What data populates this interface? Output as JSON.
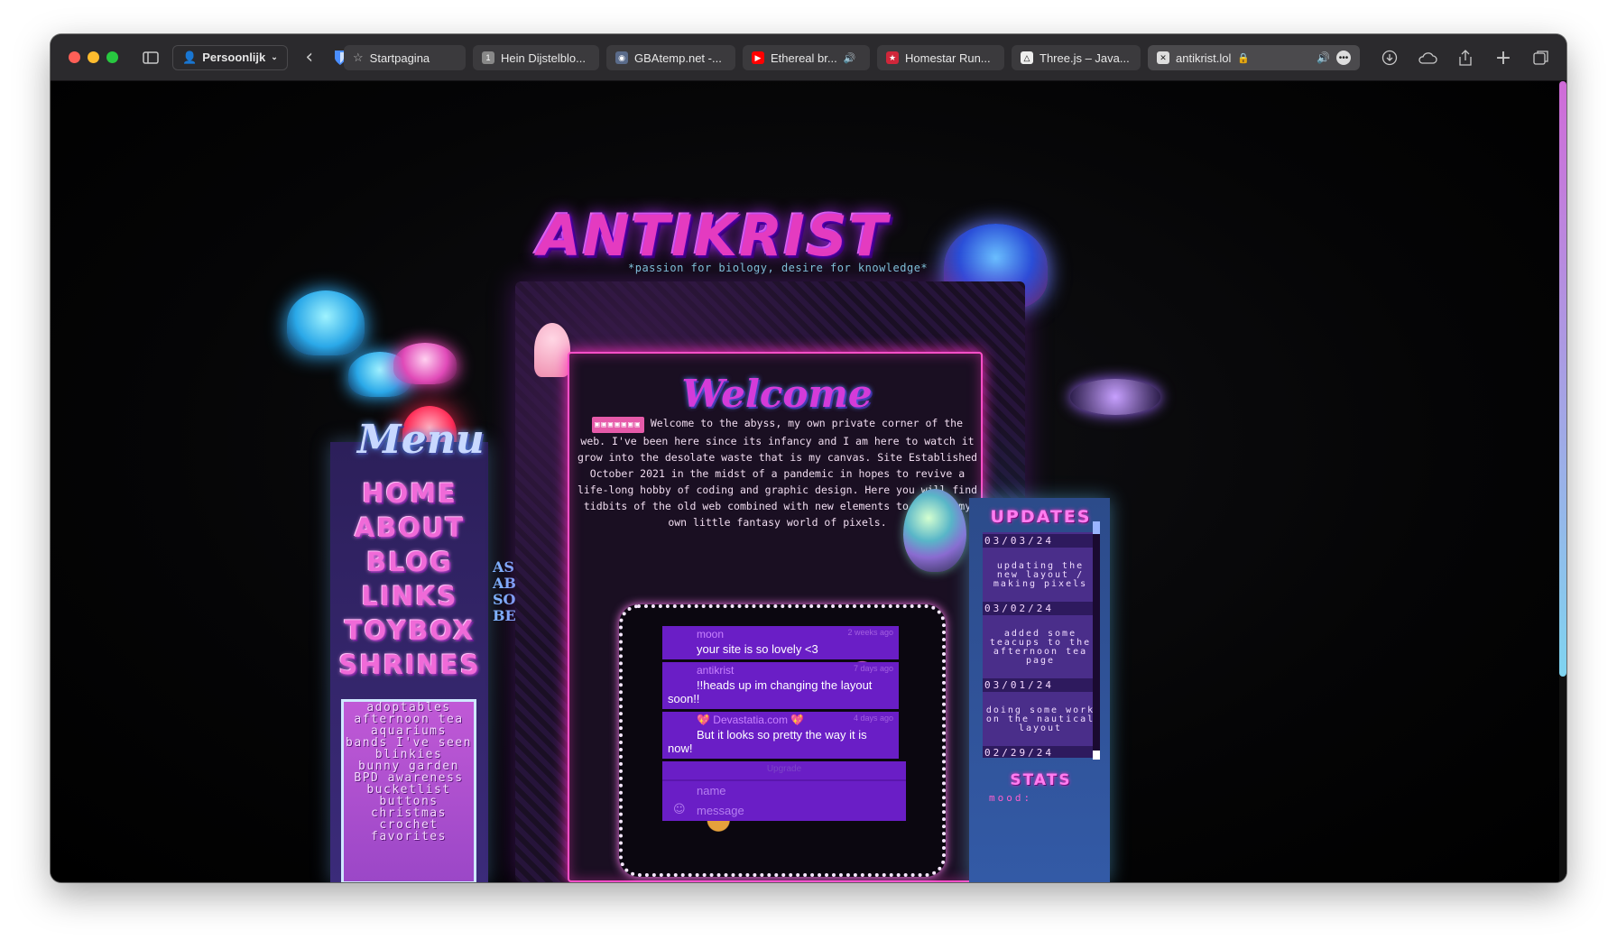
{
  "browser": {
    "profile_label": "Persoonlijk",
    "tabs": [
      {
        "label": "Startpagina",
        "icon": "star-icon"
      },
      {
        "label": "Hein Dijstelblo...",
        "icon": "bookmark-1-icon"
      },
      {
        "label": "GBAtemp.net -...",
        "icon": "gbatemp-icon"
      },
      {
        "label": "Ethereal br...",
        "icon": "youtube-icon",
        "audio": "speaker-icon"
      },
      {
        "label": "Homestar Run...",
        "icon": "homestar-icon"
      },
      {
        "label": "Three.js – Java...",
        "icon": "threejs-icon"
      },
      {
        "label": "antikrist.lol",
        "icon": "close-x-icon",
        "secure": "lock-icon",
        "active": true
      }
    ],
    "colors": {
      "close": "#ff5f57",
      "minimize": "#febc2e",
      "zoom": "#28c840"
    }
  },
  "site": {
    "logo": "ANTIKRIST",
    "tagline": "*passion for biology, desire for knowledge*",
    "menu_title": "Menu",
    "nav": [
      "HOME",
      "ABOUT",
      "BLOG",
      "LINKS",
      "TOYBOX",
      "SHRINES"
    ],
    "shrines": [
      "adoptables",
      "afternoon tea",
      "aquariums",
      "bands I've seen",
      "blinkies",
      "bunny garden",
      "BPD awareness",
      "bucketlist",
      "buttons",
      "christmas",
      "crochet",
      "favorites"
    ],
    "vertical_text": "AS ABOVE SO BELOW",
    "welcome_title": "Welcome",
    "intro_badge": "▣▣▣▣▣▣▣",
    "intro_text": "Welcome to the abyss, my own private corner of the web. I've been here since its infancy and I am here to watch it grow into the desolate waste that is my canvas. Site Established October 2021 in the midst of a pandemic in hopes to revive a life-long hobby of coding and graphic design. Here you will find tidbits of the old web combined with new elements to create my own little fantasy world of pixels.",
    "chat": {
      "messages": [
        {
          "name": "moon",
          "time": "2 weeks ago",
          "text": "your site is so lovely <3"
        },
        {
          "name": "antikrist",
          "time": "7 days ago",
          "text": "!!heads up im changing the layout soon!!"
        },
        {
          "name": "💖 Devastatia.com 💖",
          "time": "4 days ago",
          "text": "But it looks so pretty the way it is now!"
        }
      ],
      "upgrade": "Upgrade",
      "name_placeholder": "name",
      "message_placeholder": "message"
    },
    "updates_title": "UPDATES",
    "updates": [
      {
        "date": "03/03/24",
        "text": "updating the new layout / making pixels"
      },
      {
        "date": "03/02/24",
        "text": "added some teacups to the afternoon tea page"
      },
      {
        "date": "03/01/24",
        "text": "doing some work on the nautical layout"
      },
      {
        "date": "02/29/24",
        "text": ""
      }
    ],
    "stats_title": "STATS",
    "mood_label": "mood:"
  }
}
